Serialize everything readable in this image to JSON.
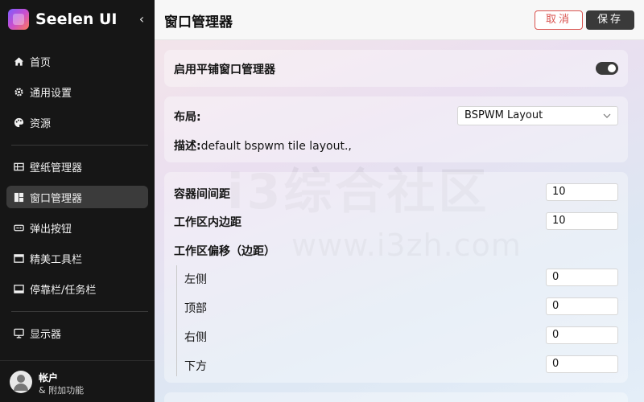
{
  "sidebar": {
    "brand": "Seelen UI",
    "collapse_icon": "‹",
    "items": [
      {
        "label": "首页",
        "icon": "home-icon"
      },
      {
        "label": "通用设置",
        "icon": "gear-icon"
      },
      {
        "label": "资源",
        "icon": "palette-icon"
      },
      {
        "label": "壁纸管理器",
        "icon": "wallpaper-icon"
      },
      {
        "label": "窗口管理器",
        "icon": "tiling-icon"
      },
      {
        "label": "弹出按钮",
        "icon": "popup-icon"
      },
      {
        "label": "精美工具栏",
        "icon": "toolbar-icon"
      },
      {
        "label": "停靠栏/任务栏",
        "icon": "dock-icon"
      },
      {
        "label": "显示器",
        "icon": "monitor-icon"
      }
    ],
    "account": {
      "name": "帐户",
      "sub": "& 附加功能"
    }
  },
  "header": {
    "title": "窗口管理器",
    "cancel_label": "取消",
    "save_label": "保存"
  },
  "settings": {
    "enable_label": "启用平铺窗口管理器",
    "enable_value": true,
    "layout_label": "布局:",
    "layout_value": "BSPWM Layout",
    "desc_label": "描述:",
    "desc_value": "default bspwm tile layout.,",
    "container_gap_label": "容器间间距",
    "container_gap_value": "10",
    "workspace_padding_label": "工作区内边距",
    "workspace_padding_value": "10",
    "workspace_offset_label": "工作区偏移（边距）",
    "left_label": "左侧",
    "left_value": "0",
    "top_label": "顶部",
    "top_value": "0",
    "right_label": "右侧",
    "right_value": "0",
    "bottom_label": "下方",
    "bottom_value": "0"
  },
  "watermark": {
    "text1": "i3综合社区",
    "text2": "www.i3zh.com"
  },
  "colors": {
    "accent_dark": "#3a3a3a",
    "cancel_red": "#d9534f",
    "sidebar_bg": "#161616"
  }
}
